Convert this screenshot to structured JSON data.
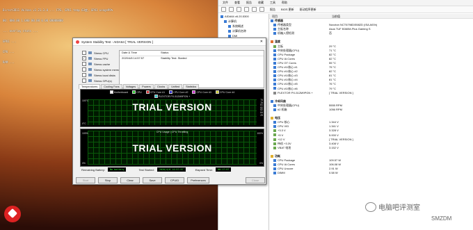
{
  "osd": {
    "lines": [
      "Direct3D11 Vulkan v1.21.3.0 ... FPS, GPU1 temp 63度, GPU1 usage99%",
      "00: 000.00 1.000 00.00 0.00 00000000",
      "... overlay stats ...",
      "GPU1 ...",
      "CPU ...",
      "RAM ..."
    ]
  },
  "aida": {
    "menu": [
      "文件",
      "查看",
      "报告",
      "收藏",
      "工具",
      "帮助"
    ],
    "toolbar": [
      "报告",
      "BIOS 更新",
      "驱动程序更新"
    ],
    "tree": [
      {
        "label": "AIDA64 v6.20.5300",
        "level": 0
      },
      {
        "label": "计算机",
        "level": 1
      },
      {
        "label": "系统概述",
        "level": 2
      },
      {
        "label": "计算机名称",
        "level": 2
      },
      {
        "label": "DMI",
        "level": 2
      }
    ],
    "header": {
      "col1": "项目",
      "col2": "当前值"
    },
    "rows": [
      {
        "k": "传感器",
        "v": "",
        "section": true,
        "color": "#3a7bd5"
      },
      {
        "k": "传感器类型",
        "v": "Nuvoton NCT6798D/5582D (ISA A00h)",
        "section": false,
        "color": "#3a7bd5"
      },
      {
        "k": "主板名称",
        "v": "Asus TUF B360M-Plus Gaming S",
        "section": false,
        "color": "#3a7bd5"
      },
      {
        "k": "机箱入侵检测",
        "v": "否",
        "section": false,
        "color": "#3a7bd5"
      },
      {
        "k": "",
        "v": "",
        "section": false,
        "color": ""
      },
      {
        "k": "温度",
        "v": "",
        "section": true,
        "color": "#e07030"
      },
      {
        "k": "主板",
        "v": "29 °C",
        "section": false,
        "color": "#6aa84f"
      },
      {
        "k": "中央处理器(CPU)",
        "v": "71 °C",
        "section": false,
        "color": "#3a7bd5"
      },
      {
        "k": "CPU Package",
        "v": "82 °C",
        "section": false,
        "color": "#3a7bd5"
      },
      {
        "k": "CPU IA Cores",
        "v": "82 °C",
        "section": false,
        "color": "#3a7bd5"
      },
      {
        "k": "CPU GT Cores",
        "v": "55 °C",
        "section": false,
        "color": "#3a7bd5"
      },
      {
        "k": "CPU #1/核心 #1",
        "v": "75 °C",
        "section": false,
        "color": "#3a7bd5"
      },
      {
        "k": "CPU #1/核心 #2",
        "v": "82 °C",
        "section": false,
        "color": "#3a7bd5"
      },
      {
        "k": "CPU #1/核心 #3",
        "v": "81 °C",
        "section": false,
        "color": "#3a7bd5"
      },
      {
        "k": "CPU #1/核心 #4",
        "v": "81 °C",
        "section": false,
        "color": "#3a7bd5"
      },
      {
        "k": "CPU #1/核心 #5",
        "v": "76 °C",
        "section": false,
        "color": "#3a7bd5"
      },
      {
        "k": "CPU #1/核心 #6",
        "v": "79 °C",
        "section": false,
        "color": "#3a7bd5"
      },
      {
        "k": "PLEXTOR PX-512M9PGN +",
        "v": "[ TRIAL VERSION ]",
        "section": false,
        "color": "#888"
      },
      {
        "k": "",
        "v": "",
        "section": false,
        "color": ""
      },
      {
        "k": "冷却风扇",
        "v": "",
        "section": true,
        "color": "#3a7bd5"
      },
      {
        "k": "中央处理器(CPU)",
        "v": "5555 RPM",
        "section": false,
        "color": "#3a7bd5"
      },
      {
        "k": "#2 机箱",
        "v": "1056 RPM",
        "section": false,
        "color": "#3a7bd5"
      },
      {
        "k": "",
        "v": "",
        "section": false,
        "color": ""
      },
      {
        "k": "电压",
        "v": "",
        "section": true,
        "color": "#e0b030"
      },
      {
        "k": "CPU 核心",
        "v": "1.344 V",
        "section": false,
        "color": "#3a7bd5"
      },
      {
        "k": "CPU VID",
        "v": "1.341 V",
        "section": false,
        "color": "#3a7bd5"
      },
      {
        "k": "+3.3 V",
        "v": "3.328 V",
        "section": false,
        "color": "#6aa84f"
      },
      {
        "k": "+5 V",
        "v": "5.000 V",
        "section": false,
        "color": "#6aa84f"
      },
      {
        "k": "+12 V",
        "v": "[ TRIAL VERSION ]",
        "section": false,
        "color": "#6aa84f"
      },
      {
        "k": "待机 +3.3V",
        "v": "3.408 V",
        "section": false,
        "color": "#6aa84f"
      },
      {
        "k": "VBAT 电池",
        "v": "3.152 V",
        "section": false,
        "color": "#6aa84f"
      },
      {
        "k": "",
        "v": "",
        "section": false,
        "color": ""
      },
      {
        "k": "功耗",
        "v": "",
        "section": true,
        "color": "#e0b030"
      },
      {
        "k": "CPU Package",
        "v": "109.57 W",
        "section": false,
        "color": "#3a7bd5"
      },
      {
        "k": "CPU IA Cores",
        "v": "106.08 W",
        "section": false,
        "color": "#3a7bd5"
      },
      {
        "k": "CPU Uncore",
        "v": "2.91 W",
        "section": false,
        "color": "#3a7bd5"
      },
      {
        "k": "DIMM",
        "v": "0.58 W",
        "section": false,
        "color": "#3a7bd5"
      }
    ]
  },
  "dialog": {
    "title": "System Stability Test - AIDA64 [ TRIAL VERSION ]",
    "checks": [
      {
        "label": "Stress CPU",
        "on": false
      },
      {
        "label": "Stress FPU",
        "on": true
      },
      {
        "label": "Stress cache",
        "on": false
      },
      {
        "label": "Stress system memory",
        "on": false
      },
      {
        "label": "Stress local disks",
        "on": false
      },
      {
        "label": "Stress GPU(s)",
        "on": false
      }
    ],
    "log_header": {
      "c1": "Date & Time",
      "c2": "Status"
    },
    "log_rows": [
      {
        "c1": "2020/4/8 14:57:57",
        "c2": "Stability Test: Started"
      }
    ],
    "tabs": [
      "Temperatures",
      "Cooling Fans",
      "Voltages",
      "Powers",
      "Clocks",
      "Unified",
      "Statistics"
    ],
    "graph1_legend": [
      "Motherboard",
      "CPU",
      "CPU Core #1",
      "CPU Core #2",
      "CPU Core #3",
      "CPU Core #4",
      "PLEXTOR PX-512M9PGN +"
    ],
    "graph1_axis": {
      "top": "100°C",
      "bottom": "0°C"
    },
    "graph1_right": [
      "75",
      "79",
      "81",
      "82",
      "82",
      "84",
      "29"
    ],
    "graph2_legend": "CPU Usage | CPU Throttling",
    "graph2_axis": {
      "top": "100%",
      "bottom": "0%",
      "top_right": "100%",
      "bottom_right": "0%"
    },
    "trial": "TRIAL VERSION",
    "remaining_battery_label": "Remaining Battery:",
    "remaining_battery": "No battery",
    "test_started_label": "Test Started:",
    "test_started": "2020/4/8 14:57:57",
    "elapsed_label": "Elapsed Time:",
    "elapsed": "00:17:57",
    "buttons": {
      "start": "Start",
      "stop": "Stop",
      "clear": "Clear",
      "save": "Save",
      "cpuid": "CPUID",
      "prefs": "Preferences",
      "close": "Close"
    }
  },
  "watermark": {
    "text": "电脑吧评测室",
    "site": "SMZDM"
  }
}
